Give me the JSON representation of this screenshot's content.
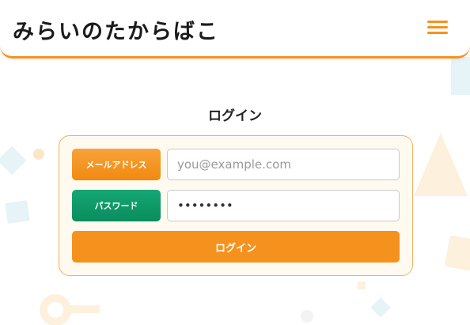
{
  "header": {
    "logo_text": "みらいのたからばこ",
    "menu_icon": "hamburger-menu-icon",
    "accent_color": "#f5921e"
  },
  "main": {
    "title": "ログイン"
  },
  "login_form": {
    "email_label": "メールアドレス",
    "email_placeholder": "you@example.com",
    "email_value": "",
    "password_label": "パスワード",
    "password_value": "••••••••",
    "submit_label": "ログイン",
    "email_label_color": "#f5921e",
    "password_label_color": "#0f9b6a"
  }
}
